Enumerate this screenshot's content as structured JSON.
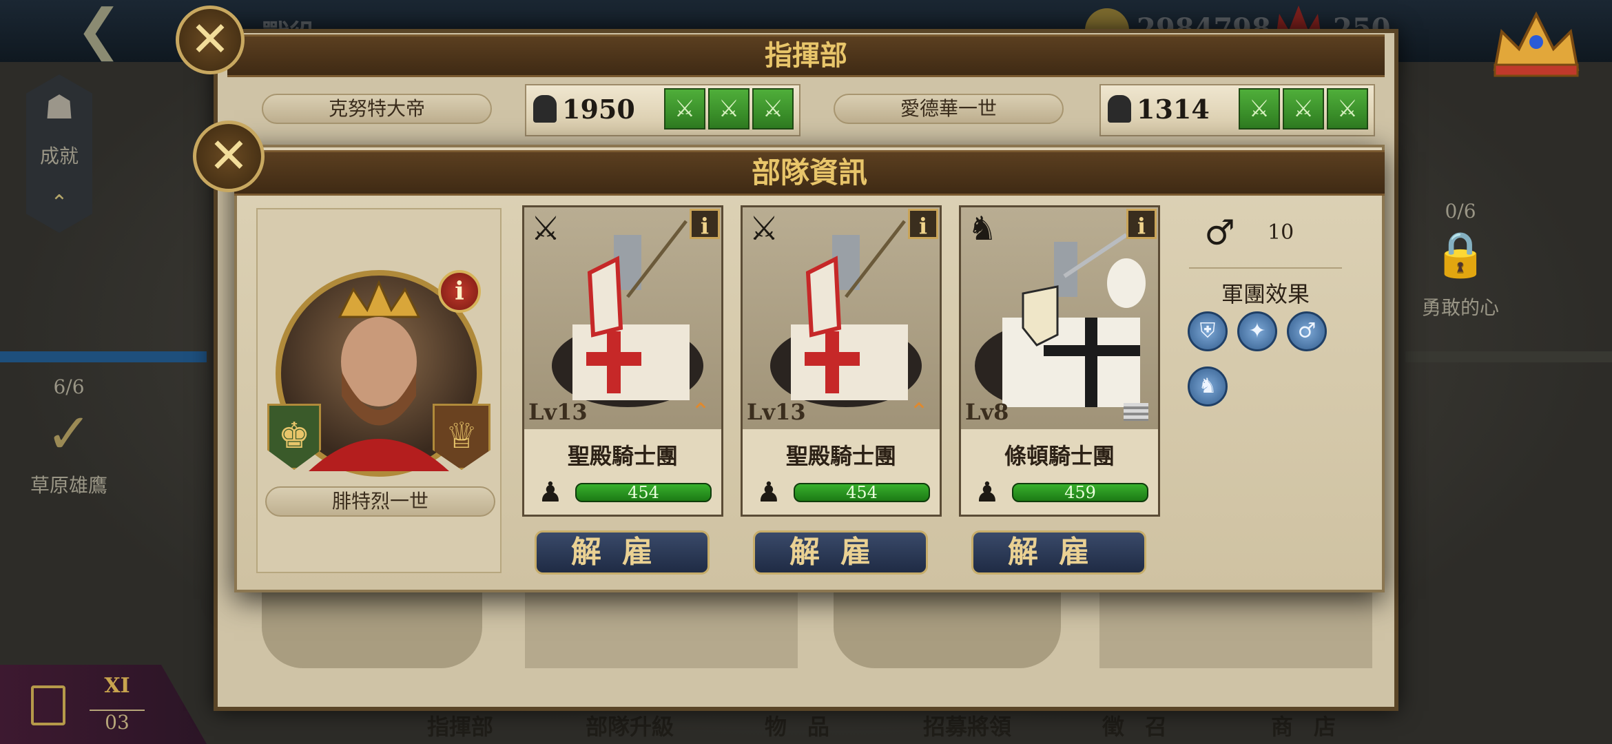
{
  "background": {
    "top_left_title": "戰役",
    "top_gold": "2984798",
    "top_right_count": "250",
    "left_badges": [
      {
        "label": "成就"
      },
      {
        "count": "6/6",
        "label": "草原雄鷹"
      }
    ],
    "right_badge": {
      "count": "0/6",
      "label": "勇敢的心"
    },
    "save": {
      "roman": "XI",
      "number": "03"
    },
    "bottom_nav": [
      "指揮部",
      "部隊升級",
      "物品",
      "招募將領",
      "徵召",
      "商店"
    ]
  },
  "command_panel": {
    "title": "指揮部",
    "commanders": [
      {
        "name": "克努特大帝",
        "power": "1950",
        "chips": [
          "⚔",
          "⚔",
          "⚔"
        ]
      },
      {
        "name": "愛德華一世",
        "power": "1314",
        "chips": [
          "⚔",
          "⚔",
          "⚔"
        ]
      }
    ]
  },
  "troop_panel": {
    "title": "部隊資訊",
    "general": {
      "name": "腓特烈一世"
    },
    "units": [
      {
        "name": "聖殿騎士團",
        "level": "Lv13",
        "count": "454",
        "type_icon": "lance-icon",
        "dismiss_label": "解雇"
      },
      {
        "name": "聖殿騎士團",
        "level": "Lv13",
        "count": "454",
        "type_icon": "lance-icon",
        "dismiss_label": "解雇"
      },
      {
        "name": "條頓騎士團",
        "level": "Lv8",
        "count": "459",
        "type_icon": "horse-icon",
        "dismiss_label": "解雇"
      }
    ],
    "movement": "10",
    "legion_effects_title": "軍團效果",
    "legion_effect_icons": [
      "shield-icon",
      "armor-icon",
      "boot-icon",
      "cavalry-icon"
    ]
  },
  "colors": {
    "accent_gold": "#e8c56a",
    "hp_green": "#38b02c",
    "button_blue": "#1f2b44"
  }
}
